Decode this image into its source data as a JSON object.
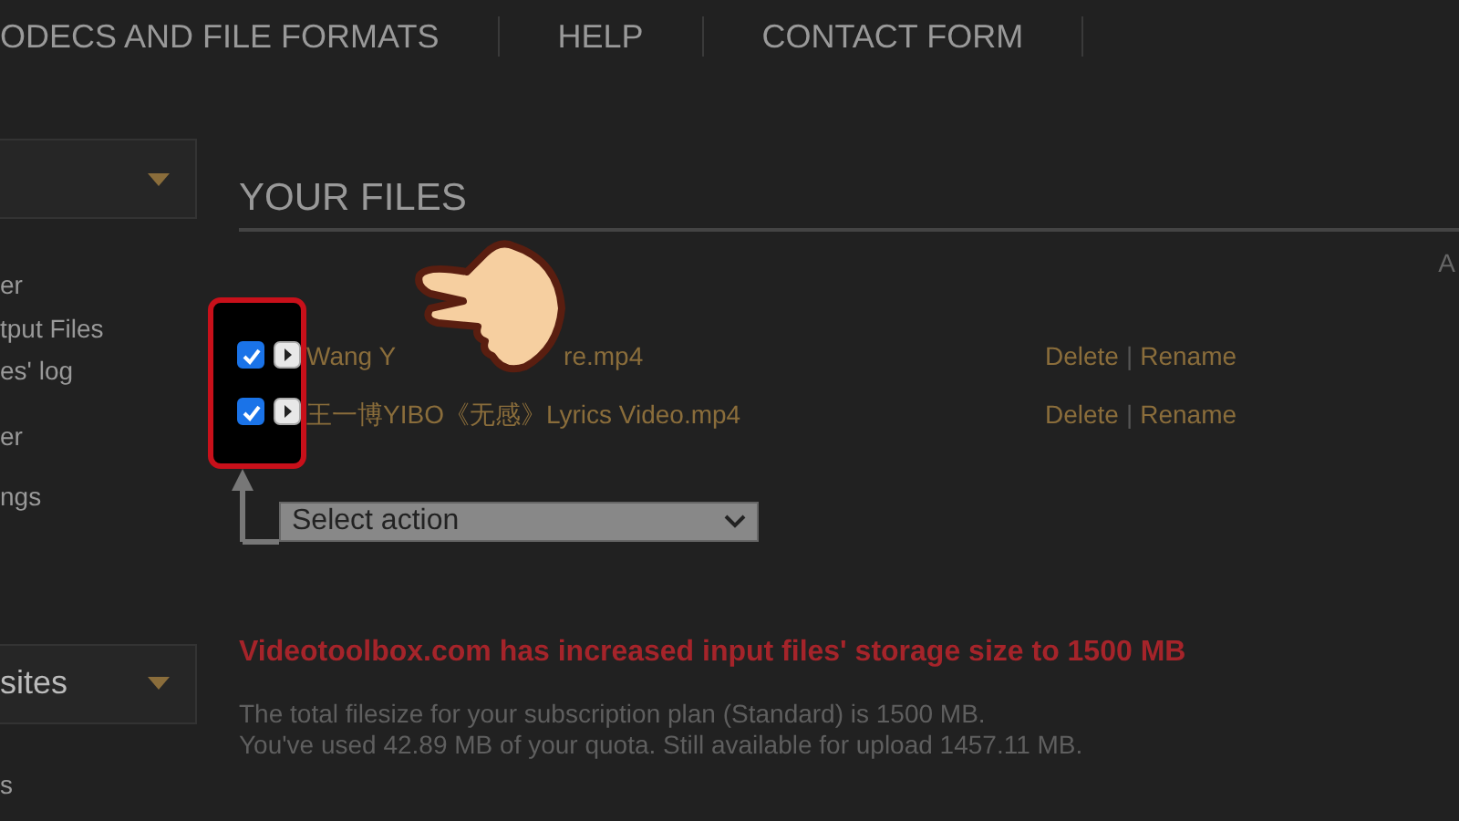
{
  "nav": [
    {
      "label": "ODECS AND FILE FORMATS"
    },
    {
      "label": "HELP"
    },
    {
      "label": "CONTACT FORM"
    }
  ],
  "sidebar": {
    "menus": [
      {
        "items": [
          "er",
          "tput Files",
          "es' log",
          "er",
          "ngs"
        ]
      },
      {
        "label": "sites",
        "items": [
          "s"
        ]
      }
    ]
  },
  "files_section": {
    "title": "YOUR FILES",
    "column_3": "A",
    "files": [
      {
        "name_start": "Wang Y",
        "name_end": "re.mp4",
        "checked": true,
        "actions": [
          "Delete",
          "Rename"
        ],
        "separator": "|"
      },
      {
        "name_start": "王一博YIBO《无感》Lyrics Video.mp4",
        "checked": true,
        "actions": [
          "Delete",
          "Rename"
        ],
        "separator": "|"
      }
    ],
    "action_select": {
      "value": "Select action"
    }
  },
  "notice": {
    "headline": "Videotoolbox.com has increased input files' storage size to 1500 MB",
    "lines": [
      "The total filesize for your subscription plan (Standard) is 1500 MB.",
      "You've used 42.89 MB of your quota. Still available for upload 1457.11 MB."
    ]
  }
}
